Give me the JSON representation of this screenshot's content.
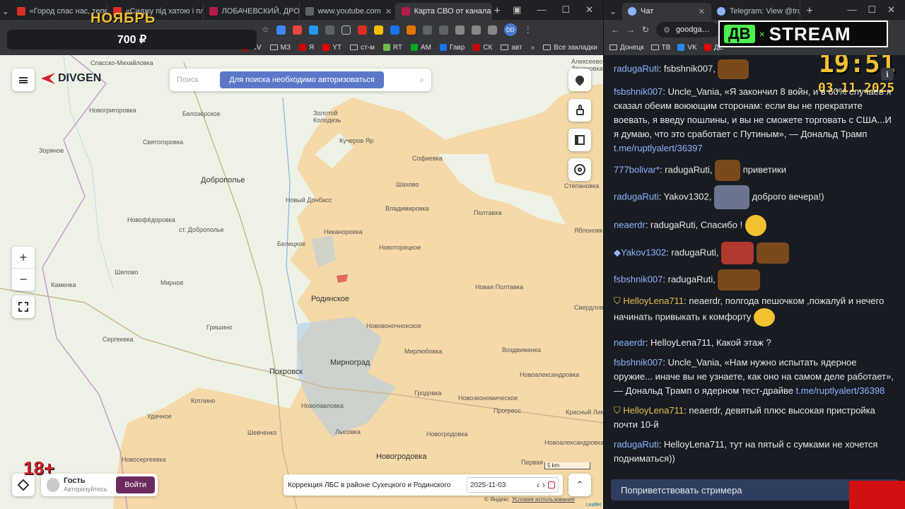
{
  "left_browser": {
    "tabs": [
      {
        "title": "«Город спас нас, тепер",
        "icon_color": "#d93025"
      },
      {
        "title": "«Сиджу під хатою і пла",
        "icon_color": "#d93025"
      },
      {
        "title": "ЛОБАЧЕВСКИЙ, ДРОН…",
        "icon_color": "#b31c4a"
      },
      {
        "title": "www.youtube.com",
        "icon_color": "#5f6368"
      },
      {
        "title": "Карта СВО от канала DI",
        "icon_color": "#b31c4a"
      }
    ],
    "bookmarks": [
      {
        "label": "UV",
        "icon": "bookmark-icon",
        "color": "#c00"
      },
      {
        "label": "МЗ",
        "icon": "folder-icon",
        "color": "#c9c9c9"
      },
      {
        "label": "Я",
        "icon": "yandex-icon",
        "color": "#d40000"
      },
      {
        "label": "YT",
        "icon": "youtube-icon",
        "color": "#e00"
      },
      {
        "label": "ст-м",
        "icon": "folder-icon",
        "color": "#c9c9c9"
      },
      {
        "label": "RT",
        "icon": "rt-icon",
        "color": "#6cbe45"
      },
      {
        "label": "АМ",
        "icon": "am-icon",
        "color": "#0a2"
      },
      {
        "label": "Гавр",
        "icon": "gavr-icon",
        "color": "#1a73e8"
      },
      {
        "label": "СК",
        "icon": "sk-icon",
        "color": "#c00"
      },
      {
        "label": "авт",
        "icon": "folder-icon",
        "color": "#c9c9c9"
      }
    ],
    "all_bookmarks": "Все закладки"
  },
  "overlay": {
    "month": "НОЯБРЬ",
    "price": "700 ₽",
    "age": "18+"
  },
  "map": {
    "brand": "DIVGEN",
    "search_placeholder": "Поиск",
    "auth_banner": "Для поиска необходимо авторизоваться",
    "zoom_in": "+",
    "zoom_out": "−",
    "user_name": "Гость",
    "user_sub": "Авторизуйтесь",
    "login_button": "Войти",
    "news_title": "Коррекция ЛБС в районе Сухецкого и Родинского",
    "date": "2025-11-03",
    "scale": "5 km",
    "copyright": "© Яндекс",
    "terms": "Условия использования",
    "leaflet": "Leaflet",
    "places": [
      {
        "name": "Спасско-Михайловка",
        "big": false
      },
      {
        "name": "Новогригоровка",
        "big": false
      },
      {
        "name": "Белозёрское",
        "big": false
      },
      {
        "name": "Золотой Колодезь",
        "big": false
      },
      {
        "name": "Кучеров Яр",
        "big": false
      },
      {
        "name": "Зоряное",
        "big": false
      },
      {
        "name": "Святогоровка",
        "big": false
      },
      {
        "name": "Доброполье",
        "big": true
      },
      {
        "name": "Софиевка",
        "big": false
      },
      {
        "name": "Шахово",
        "big": false
      },
      {
        "name": "Новый Донбасс",
        "big": false
      },
      {
        "name": "Владимировка",
        "big": false
      },
      {
        "name": "Полтавка",
        "big": false
      },
      {
        "name": "Новофёдоровка",
        "big": false
      },
      {
        "name": "ст. Доброполье",
        "big": false
      },
      {
        "name": "Никаноровка",
        "big": false
      },
      {
        "name": "Белицкое",
        "big": false
      },
      {
        "name": "Новоторецкое",
        "big": false
      },
      {
        "name": "Шилово",
        "big": false
      },
      {
        "name": "Мирное",
        "big": false
      },
      {
        "name": "Каменка",
        "big": false
      },
      {
        "name": "Родинское",
        "big": true
      },
      {
        "name": "Новая Полтавка",
        "big": false
      },
      {
        "name": "Гришино",
        "big": false
      },
      {
        "name": "Нововоночнокское",
        "big": false
      },
      {
        "name": "Сергеевка",
        "big": false
      },
      {
        "name": "Мирноград",
        "big": true
      },
      {
        "name": "Покровск",
        "big": true
      },
      {
        "name": "Мирлюбовка",
        "big": false
      },
      {
        "name": "Воздвиженка",
        "big": false
      },
      {
        "name": "Котлино",
        "big": false
      },
      {
        "name": "Новопавловка",
        "big": false
      },
      {
        "name": "Гродовка",
        "big": false
      },
      {
        "name": "Новоэкономическое",
        "big": false
      },
      {
        "name": "Удачное",
        "big": false
      },
      {
        "name": "Шевченко",
        "big": false
      },
      {
        "name": "Лысовка",
        "big": false
      },
      {
        "name": "Новоалександровка",
        "big": false
      },
      {
        "name": "Прогресс",
        "big": false
      },
      {
        "name": "Новогродовка",
        "big": true
      },
      {
        "name": "Новосергеевка",
        "big": false
      },
      {
        "name": "Первая",
        "big": false
      },
      {
        "name": "Степановка",
        "big": false
      },
      {
        "name": "Алексеево-Дружковка",
        "big": false
      },
      {
        "name": "Яблоновка",
        "big": false
      },
      {
        "name": "Свердлово",
        "big": false
      },
      {
        "name": "Красный Лиман",
        "big": false
      },
      {
        "name": "Новоалександровка",
        "big": false
      },
      {
        "name": "Новогродовка",
        "big": false
      }
    ]
  },
  "right_browser": {
    "tabs": [
      {
        "title": "Чат",
        "icon_color": "#8ab4f8"
      },
      {
        "title": "Telegram: View @true",
        "icon_color": "#8ab4f8"
      }
    ],
    "address": "goodga…",
    "bookmarks": [
      "Донецк",
      "ТВ",
      "VK",
      "ДЕ"
    ],
    "overlay_logo_left": "ДВ",
    "overlay_logo_right": "STREAM",
    "clock": "19:51",
    "date": "03.11.2025",
    "greet_button": "Поприветствовать стримера"
  },
  "chat": [
    {
      "nick": "radugaRuti",
      "text": "fsbshnik007,",
      "gold": false,
      "badge": false
    },
    {
      "nick": "fsbshnik007",
      "text": "Uncle_Vania, «Я закончил 8 войн, и в 60% случаев я сказал обеим воюющим сторонам: если вы не прекратите воевать, я введу пошлины, и вы не сможете торговать с США...И я думаю, что это сработает с Путиным», — Дональд Трамп",
      "link": "t.me/ruptlyalert/36397",
      "gold": false,
      "badge": false
    },
    {
      "nick": "777bolivar*",
      "text": "radugaRuti,",
      "suffix": "приветики",
      "gold": false,
      "badge": false
    },
    {
      "nick": "radugaRuti",
      "text": "Yakov1302,",
      "suffix": "доброго вечера!)",
      "gold": false,
      "badge": false
    },
    {
      "nick": "neaerdr",
      "text": "radugaRuti, Спасибо !",
      "gold": false,
      "badge": false
    },
    {
      "nick": "Yakov1302",
      "text": "radugaRuti,",
      "gold": false,
      "badge": true
    },
    {
      "nick": "fsbshnik007",
      "text": "radugaRuti,",
      "gold": false,
      "badge": false
    },
    {
      "nick": "HelloyLena711",
      "text": "neaerdr, полгода пешочком ,пожалуй и нечего начинать привыкать к комфорту",
      "gold": true,
      "badge": true
    },
    {
      "nick": "neaerdr",
      "text": "HelloyLena711, Какой этаж ?",
      "gold": false,
      "badge": false
    },
    {
      "nick": "fsbshnik007",
      "text": "Uncle_Vania, «Нам нужно испытать ядерное оружие... иначе вы не узнаете, как оно на самом деле работает», — Дональд Трамп о ядерном тест-драйве",
      "link": "t.me/ruptlyalert/36398",
      "gold": false,
      "badge": false
    },
    {
      "nick": "HelloyLena711",
      "text": "neaerdr, девятый плюс высокая пристройка почти 10-й",
      "gold": true,
      "badge": true
    },
    {
      "nick": "radugaRuti",
      "text": "HelloyLena711, тут на пятый с сумками не хочется подниматься))",
      "gold": false,
      "badge": false
    }
  ],
  "colors": {
    "occupied": "#f5d9a8",
    "map_bg": "#eef2e6",
    "water": "#a9cbe8",
    "brand_red": "#d3202f",
    "login_btn": "#6b2a5e",
    "chat_bg": "#181b21",
    "nick": "#8fb4ff",
    "gold": "#e3c24f"
  }
}
